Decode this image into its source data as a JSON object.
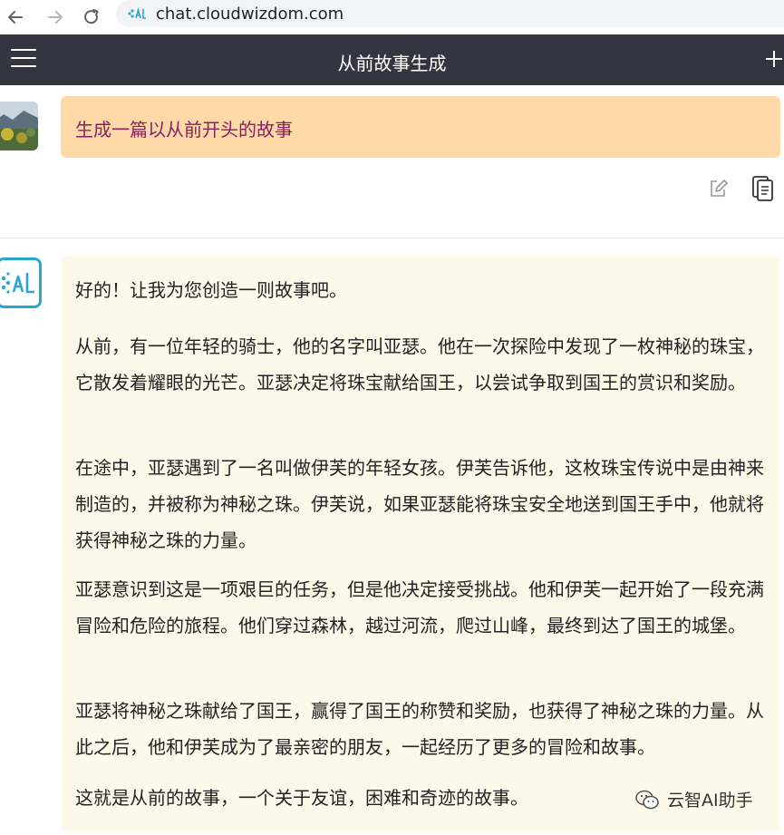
{
  "browser": {
    "url": "chat.cloudwizdom.com"
  },
  "header": {
    "title": "从前故事生成"
  },
  "user_message": {
    "text": "生成一篇以从前开头的故事"
  },
  "ai_message": {
    "paragraphs": [
      "好的！让我为您创造一则故事吧。",
      "从前，有一位年轻的骑士，他的名字叫亚瑟。他在一次探险中发现了一枚神秘的珠宝，它散发着耀眼的光芒。亚瑟决定将珠宝献给国王，以尝试争取到国王的赏识和奖励。",
      "在途中，亚瑟遇到了一名叫做伊芙的年轻女孩。伊芙告诉他，这枚珠宝传说中是由神来制造的，并被称为神秘之珠。伊芙说，如果亚瑟能将珠宝安全地送到国王手中，他就将获得神秘之珠的力量。",
      "亚瑟意识到这是一项艰巨的任务，但是他决定接受挑战。他和伊芙一起开始了一段充满冒险和危险的旅程。他们穿过森林，越过河流，爬过山峰，最终到达了国王的城堡。",
      "亚瑟将神秘之珠献给了国王，赢得了国王的称赞和奖励，也获得了神秘之珠的力量。从此之后，他和伊芙成为了最亲密的朋友，一起经历了更多的冒险和故事。",
      "这就是从前的故事，一个关于友谊，困难和奇迹的故事。"
    ]
  },
  "watermark": {
    "text": "云智AI助手"
  },
  "colors": {
    "header_bg": "#343541",
    "user_bubble": "#ffd9a8",
    "user_text": "#8a2060",
    "ai_bubble": "#fdf9ea",
    "ai_avatar_border": "#2aa6d1"
  },
  "icons": [
    "back-arrow-icon",
    "forward-arrow-icon",
    "reload-icon",
    "site-logo-icon",
    "menu-icon",
    "plus-icon",
    "edit-icon",
    "copy-icon",
    "ai-logo-icon",
    "wechat-icon"
  ]
}
